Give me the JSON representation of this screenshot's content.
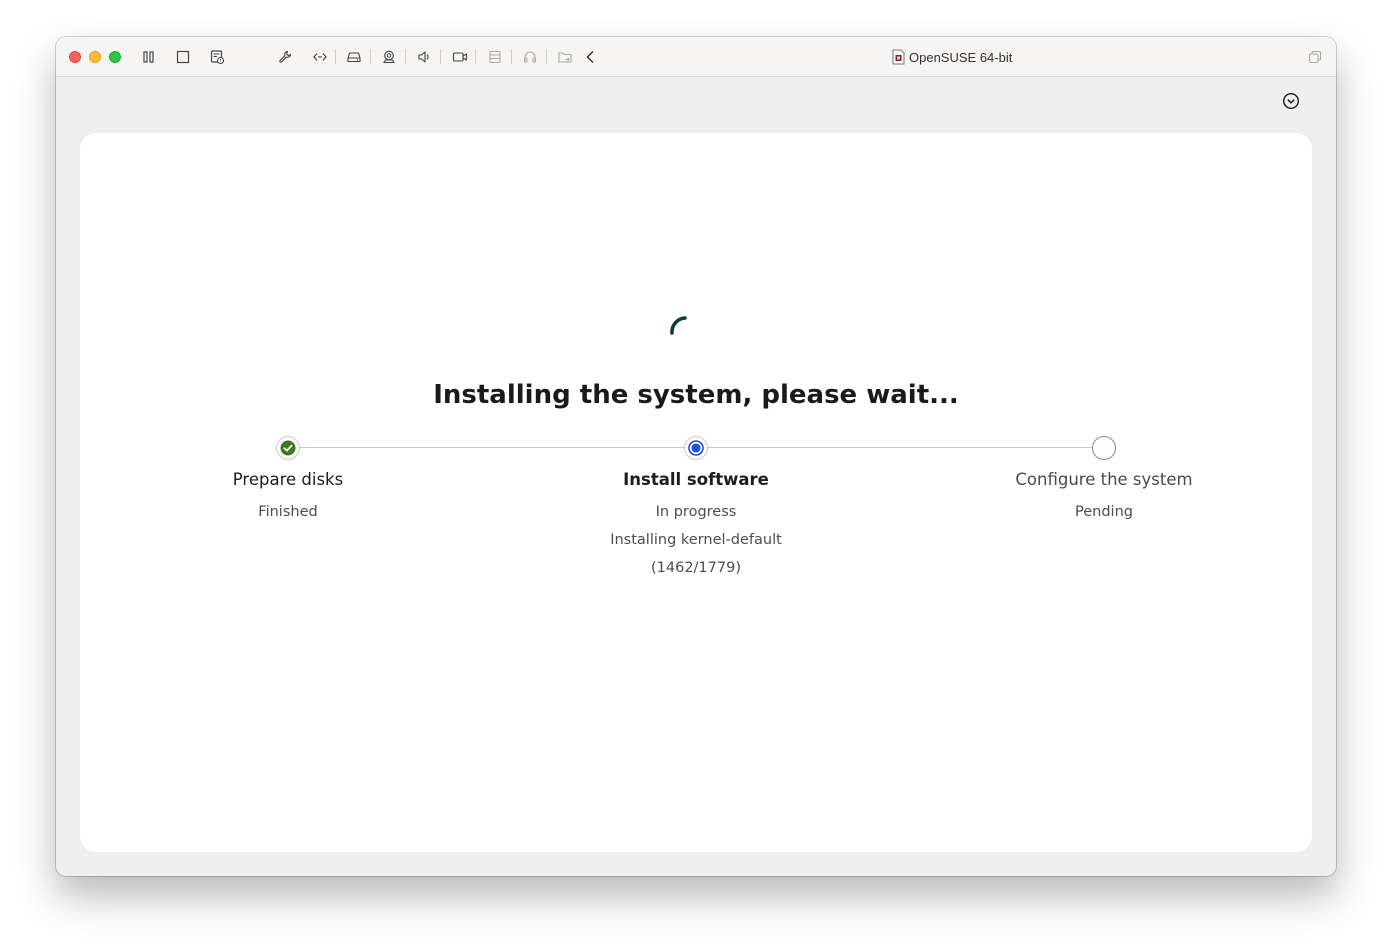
{
  "window": {
    "title": "OpenSUSE 64-bit",
    "toolbar_icons": [
      "sidebar-icon",
      "stop-icon",
      "snapshot-icon",
      "wrench-icon",
      "code-icon",
      "hard-disk-icon",
      "camera-icon",
      "sound-icon",
      "video-icon",
      "storage-icon",
      "headphones-icon",
      "shared-folder-icon",
      "back-chevron-icon"
    ]
  },
  "installer": {
    "heading": "Installing the system, please wait...",
    "steps": [
      {
        "title": "Prepare disks",
        "status": "Finished",
        "state": "done"
      },
      {
        "title": "Install software",
        "status": "In progress",
        "detail": "Installing kernel-default",
        "progress_text": "(1462/1779)",
        "state": "current",
        "progress": {
          "done": 1462,
          "total": 1779
        }
      },
      {
        "title": "Configure the system",
        "status": "Pending",
        "state": "pending"
      }
    ]
  },
  "colors": {
    "done": "#3a7a1e",
    "current": "#1f4de6",
    "pending_border": "#8a8a8a",
    "spinner": "#0d3b36"
  }
}
